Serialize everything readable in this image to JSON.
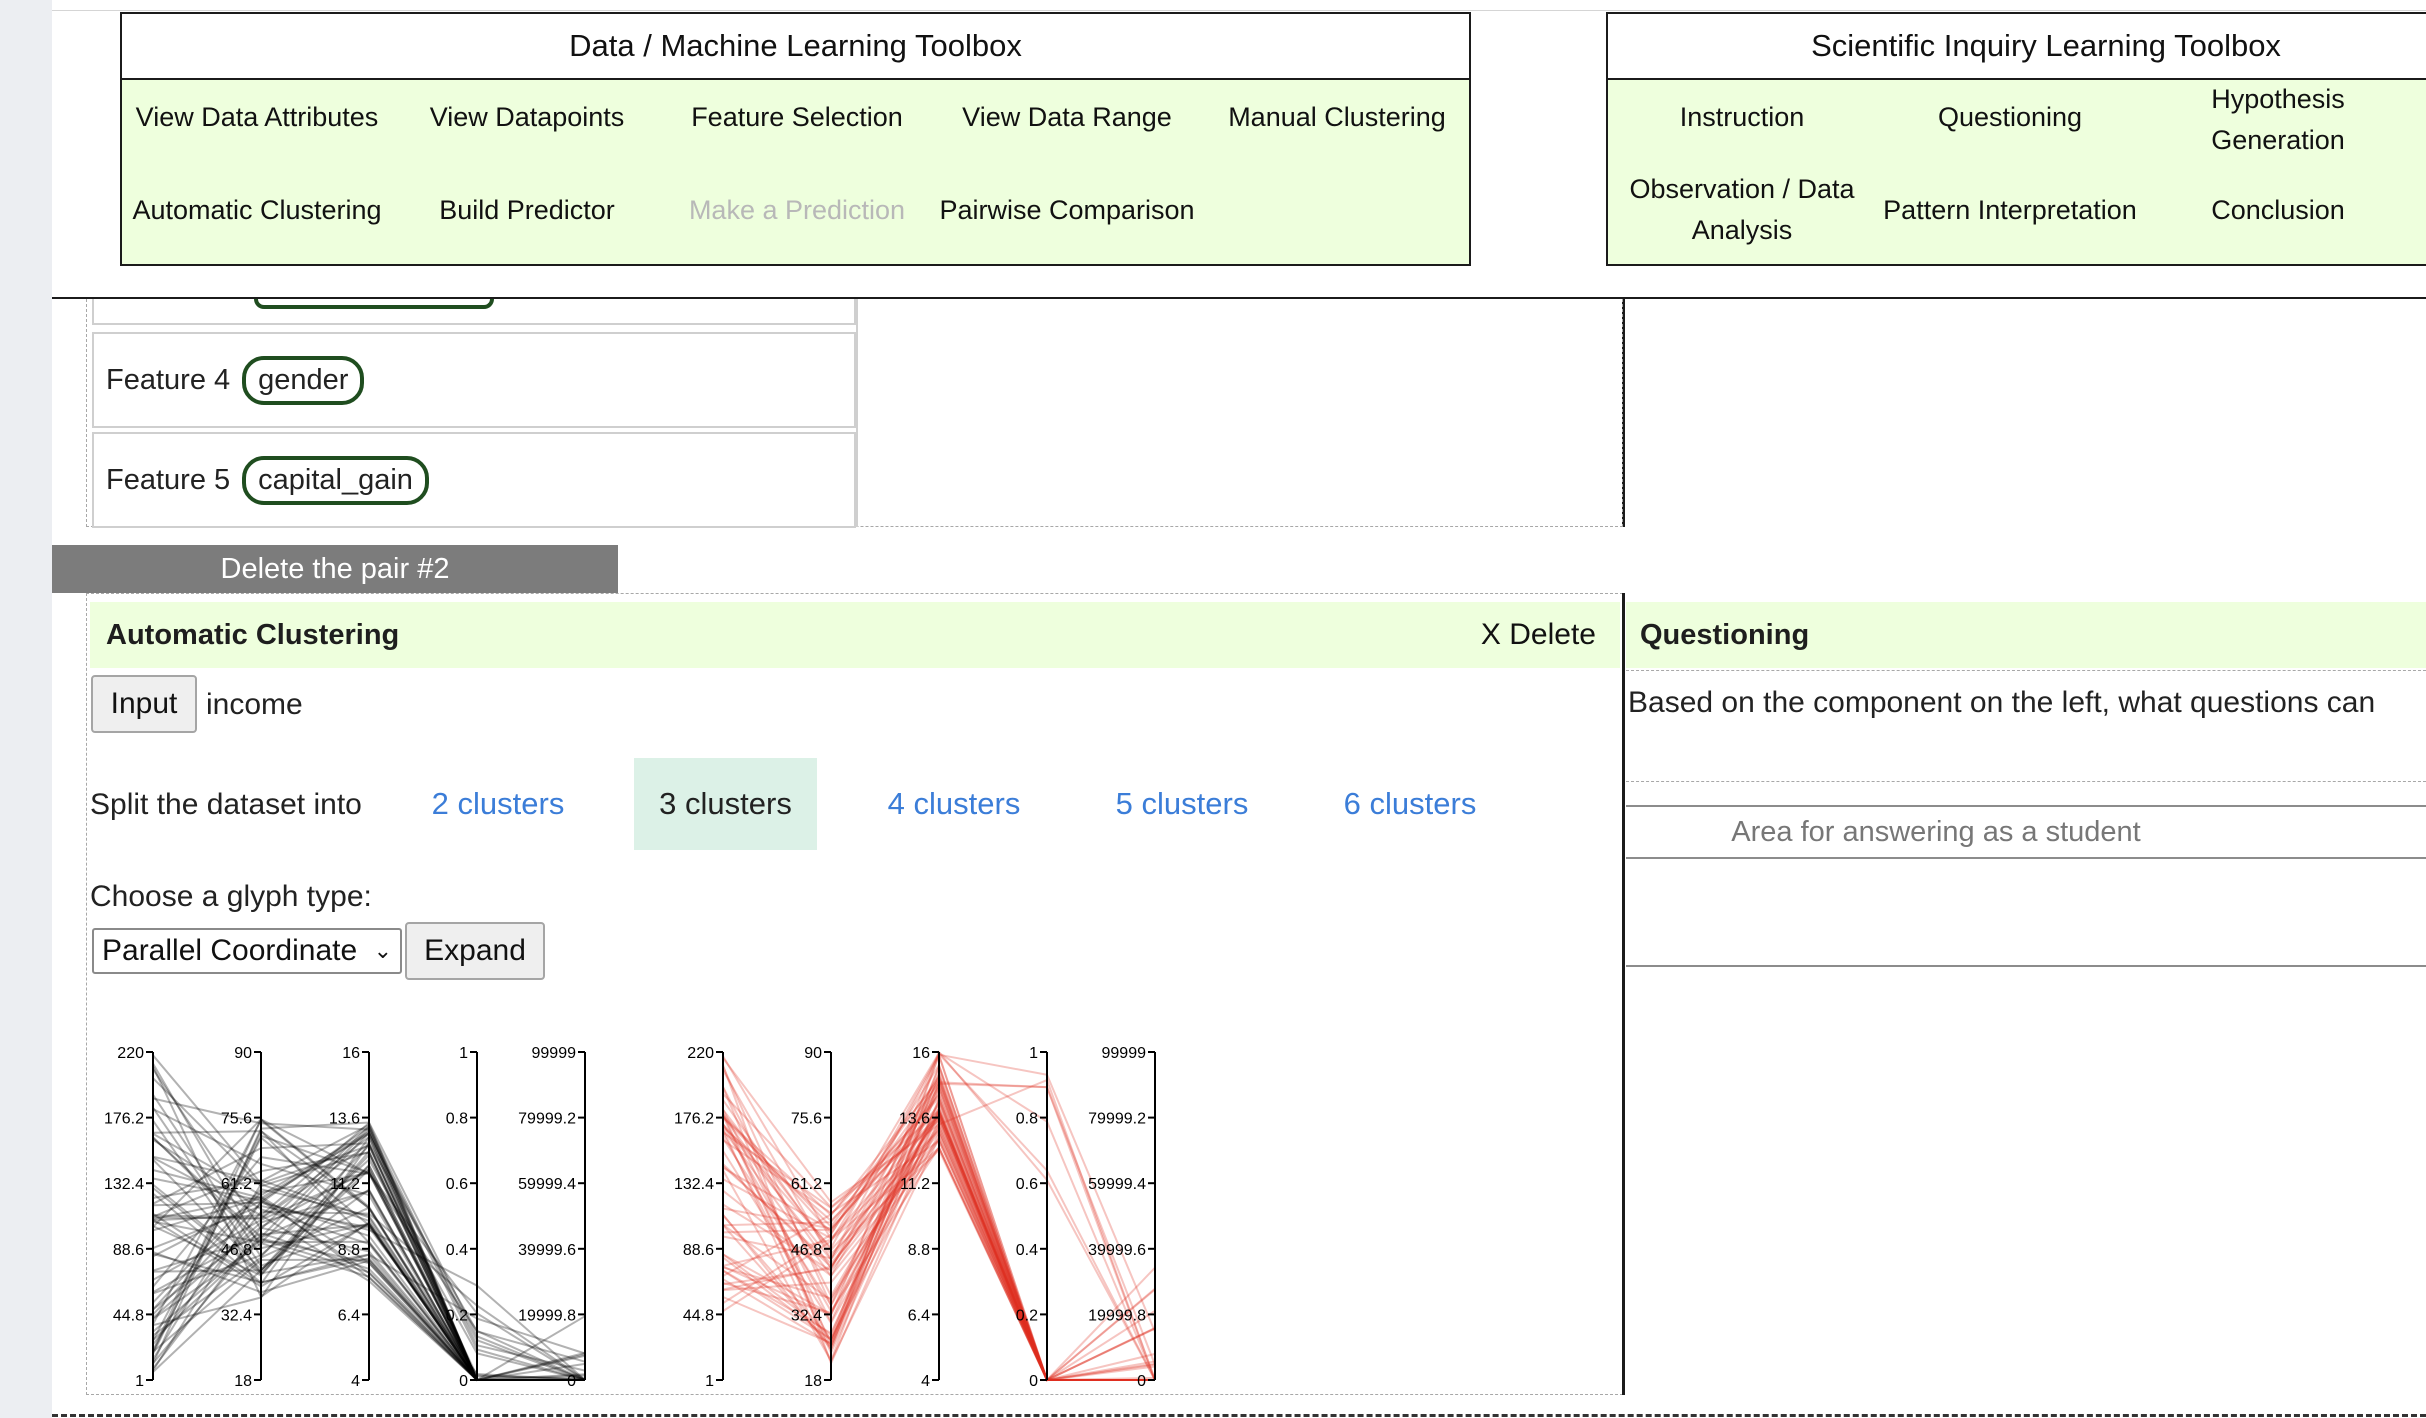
{
  "data_toolbox": {
    "title": "Data / Machine Learning Toolbox",
    "items": [
      {
        "label": "View Data Attributes",
        "enabled": true
      },
      {
        "label": "View Datapoints",
        "enabled": true
      },
      {
        "label": "Feature Selection",
        "enabled": true
      },
      {
        "label": "View Data Range",
        "enabled": true
      },
      {
        "label": "Manual Clustering",
        "enabled": true
      },
      {
        "label": "Automatic Clustering",
        "enabled": true
      },
      {
        "label": "Build Predictor",
        "enabled": true
      },
      {
        "label": "Make a Prediction",
        "enabled": false
      },
      {
        "label": "Pairwise Comparison",
        "enabled": true
      }
    ]
  },
  "inquiry_toolbox": {
    "title": "Scientific Inquiry Learning Toolbox",
    "items": [
      {
        "label": "Instruction"
      },
      {
        "label": "Questioning"
      },
      {
        "label": "Hypothesis Generation"
      },
      {
        "label": "Observation / Data Analysis"
      },
      {
        "label": "Pattern Interpretation"
      },
      {
        "label": "Conclusion"
      }
    ]
  },
  "features": [
    {
      "label": "Feature 4",
      "value": "gender"
    },
    {
      "label": "Feature 5",
      "value": "capital_gain"
    }
  ],
  "delete_pair_label": "Delete the pair #2",
  "clustering_panel": {
    "title": "Automatic Clustering",
    "delete_label": "X Delete",
    "input_button": "Input",
    "input_value": "income",
    "split_label": "Split the dataset into",
    "cluster_options": [
      "2 clusters",
      "3 clusters",
      "4 clusters",
      "5 clusters",
      "6 clusters"
    ],
    "selected_cluster": "3 clusters",
    "glyph_label": "Choose a glyph type:",
    "glyph_selected": "Parallel Coordinate",
    "expand_button": "Expand"
  },
  "questioning_panel": {
    "title": "Questioning",
    "prompt": "Based on the component on the left, what questions can",
    "answer_placeholder": "Area for answering as a student"
  },
  "colors": {
    "toolbox_bg": "#eeffdd",
    "selected_cluster_bg": "#dcf1e7",
    "link": "#3b7dd8",
    "cluster1_lines": "#000000",
    "cluster2_lines": "#e03020"
  },
  "chart_data": {
    "type": "line",
    "axes": [
      {
        "ticks": [
          "220",
          "176.2",
          "132.4",
          "88.6",
          "44.8",
          "1"
        ],
        "range": [
          1,
          220
        ]
      },
      {
        "ticks": [
          "90",
          "75.6",
          "61.2",
          "46.8",
          "32.4",
          "18"
        ],
        "range": [
          18,
          90
        ]
      },
      {
        "ticks": [
          "16",
          "13.6",
          "11.2",
          "8.8",
          "6.4",
          "4"
        ],
        "range": [
          4,
          16
        ]
      },
      {
        "ticks": [
          "1",
          "0.8",
          "0.6",
          "0.4",
          "0.2",
          "0"
        ],
        "range": [
          0,
          1
        ]
      },
      {
        "ticks": [
          "99999",
          "79999.2",
          "59999.4",
          "39999.6",
          "19999.8",
          "0"
        ],
        "range": [
          0,
          99999
        ]
      }
    ],
    "glyphs": [
      {
        "color": "#000000"
      },
      {
        "color": "#e03020"
      }
    ]
  }
}
